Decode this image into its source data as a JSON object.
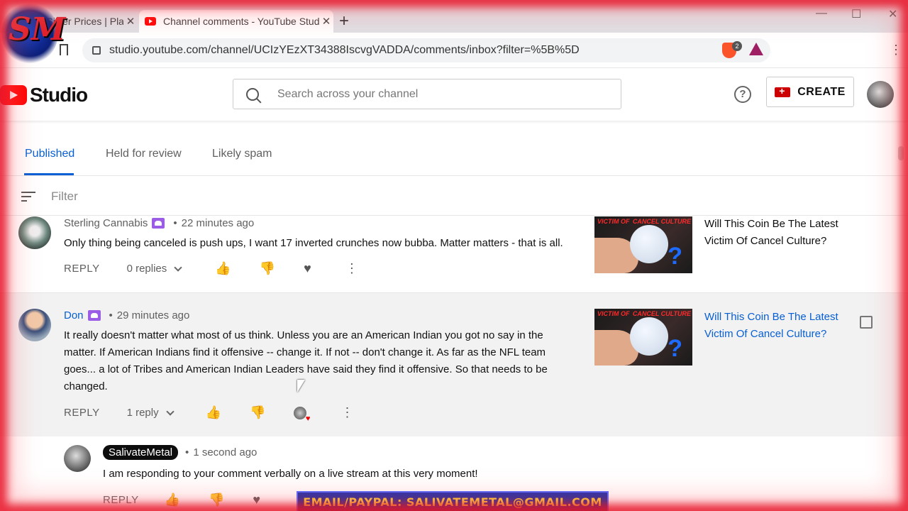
{
  "browser": {
    "tabs": [
      {
        "title": "| Silver Prices | Pla",
        "close": "✕"
      },
      {
        "title": "Channel comments - YouTube Stud",
        "close": "✕"
      }
    ],
    "new_tab": "+",
    "url": "studio.youtube.com/channel/UCIzYEzXT34388IscvgVADDA/comments/inbox?filter=%5B%5D",
    "brave_badge": "2",
    "window_controls": {
      "minimize": "—",
      "maximize": "☐",
      "close": "✕"
    },
    "menu": "⋮"
  },
  "studio": {
    "logo_text": "Studio",
    "search_placeholder": "Search across your channel",
    "help": "?",
    "create_label": "CREATE"
  },
  "comment_tabs": [
    {
      "label": "Published",
      "active": true
    },
    {
      "label": "Held for review",
      "active": false
    },
    {
      "label": "Likely spam",
      "active": false
    }
  ],
  "filter_label": "Filter",
  "comments": [
    {
      "author": "Sterling Cannabis",
      "time": "22 minutes ago",
      "text": "Only thing being canceled is push ups, I want 17 inverted crunches now bubba. Matter matters - that is all.",
      "reply": "REPLY",
      "replies": "0 replies",
      "video_title": "Will This Coin Be The Latest Victim Of Cancel Culture?"
    },
    {
      "author": "Don",
      "time": "29 minutes ago",
      "text_lines": [
        "It really doesn't matter what most of us think. Unless you are an American Indian you got no say in the",
        "matter. If American Indians find it offensive -- change it. If not -- don't change it. As far as the NFL team",
        "goes... a lot of Tribes and American Indian Leaders have said they find it offensive. So that needs to be",
        "changed."
      ],
      "reply": "REPLY",
      "replies": "1 reply",
      "video_title": "Will This Coin Be The Latest Victim Of Cancel Culture?"
    }
  ],
  "reply_comment": {
    "author": "SalivateMetal",
    "time": "1 second ago",
    "text": "I am responding to your comment verbally on a live stream at this very moment!",
    "reply": "REPLY"
  },
  "thumbnail": {
    "top_left": "VICTIM OF",
    "top_right": "CANCEL CULTURE",
    "mark": "?"
  },
  "overlay": {
    "logo_text": "SM",
    "email_banner": "EMAIL/PAYPAL: SALIVATEMETAL@GMAIL.COM"
  },
  "separator_dot": "•",
  "colors": {
    "accent": "#065fd4",
    "youtube_red": "#ff0000",
    "member_badge": "#9b5de5",
    "banner_text": "#ffd92e"
  }
}
